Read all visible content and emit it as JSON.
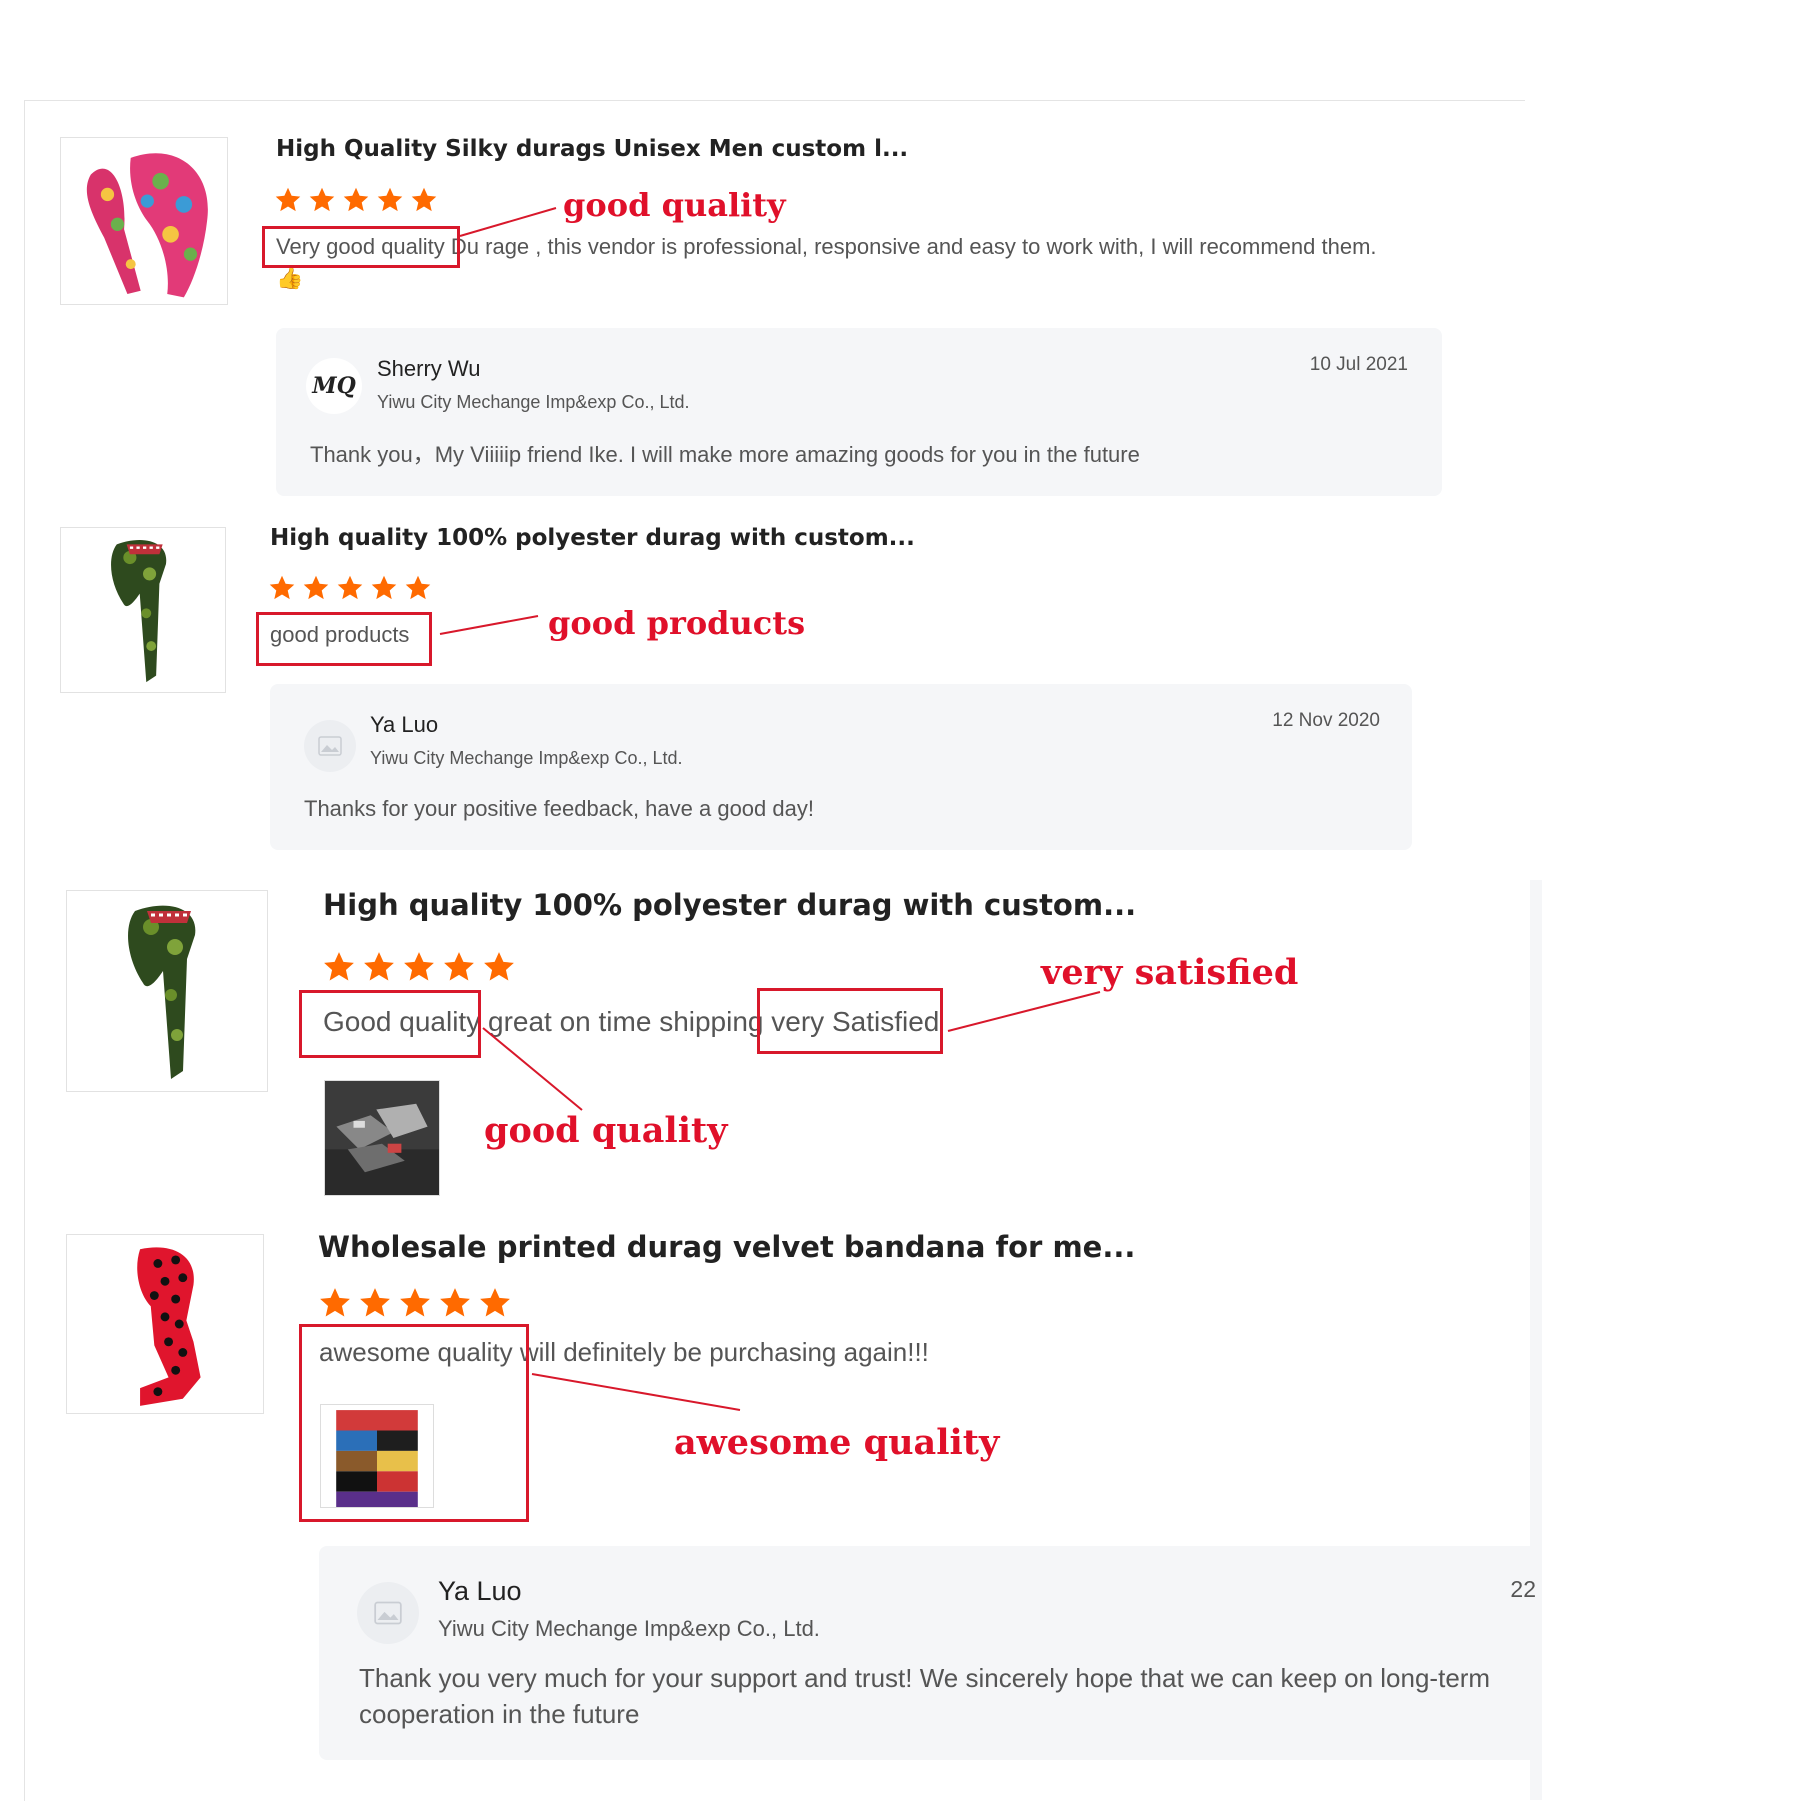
{
  "reviews": [
    {
      "product_title": "High Quality Silky durags Unisex Men custom l...",
      "rating": 5,
      "text": "Very good quality Du rage , this vendor is professional, responsive and easy to work with, I will recommend them.",
      "emoji": "👍",
      "reply": {
        "name": "Sherry Wu",
        "company": "Yiwu City Mechange Imp&exp Co., Ltd.",
        "date": "10 Jul 2021",
        "text": "Thank you，My Viiiiip friend Ike. I will make more amazing goods for you in the future",
        "avatar_text": "MQ"
      }
    },
    {
      "product_title": "High quality 100% polyester durag with custom...",
      "rating": 5,
      "text": "good products",
      "reply": {
        "name": "Ya Luo",
        "company": "Yiwu City Mechange Imp&exp Co., Ltd.",
        "date": "12 Nov 2020",
        "text": "Thanks for your positive feedback, have a good day!"
      }
    },
    {
      "product_title": "High quality 100% polyester durag with custom...",
      "rating": 5,
      "text": "Good quality great on time shipping very Satisfied"
    },
    {
      "product_title": "Wholesale printed durag velvet bandana for me...",
      "rating": 5,
      "text": "awesome quality will definitely be purchasing again!!!",
      "reply": {
        "name": "Ya Luo",
        "company": "Yiwu City Mechange Imp&exp Co., Ltd.",
        "date": "22",
        "text": "Thank you very much for your support and trust! We sincerely hope that we can keep on long-term cooperation in the future"
      }
    }
  ],
  "annotations": {
    "a1": "good quality",
    "a2": "good products",
    "a3": "very satisfied",
    "a4": "good quality",
    "a5": "awesome quality"
  },
  "colors": {
    "star": "#ff6a00",
    "annotation": "#e0102a",
    "reply_bg": "#f5f6f8"
  },
  "icons": [
    "star-icon",
    "thumbs-up-icon",
    "company-avatar-icon",
    "image-placeholder-icon"
  ]
}
